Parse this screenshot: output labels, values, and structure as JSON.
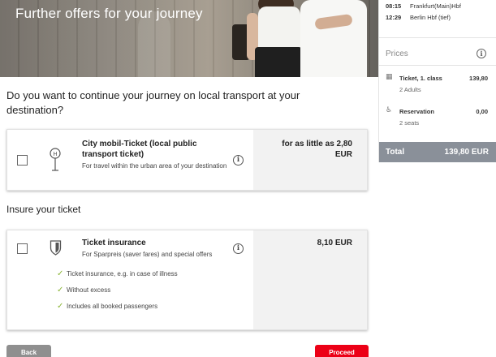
{
  "hero": {
    "title": "Further offers for your journey"
  },
  "sidebar": {
    "trip": [
      {
        "time": "08:15",
        "station": "Frankfurt(Main)Hbf"
      },
      {
        "time": "12:29",
        "station": "Berlin Hbf (tief)"
      }
    ],
    "prices_title": "Prices",
    "info_icon": "i",
    "items": [
      {
        "icon": "seat-icon",
        "label": "Ticket, 1. class",
        "sub": "2 Adults",
        "price": "139,80"
      },
      {
        "icon": "reservation-seat-icon",
        "label": "Reservation",
        "sub": "2 seats",
        "price": "0,00"
      }
    ],
    "total_label": "Total",
    "total_value": "139,80 EUR"
  },
  "main": {
    "question": "Do you want to continue your journey on local transport at your destination?",
    "city_ticket": {
      "title": "City mobil-Ticket (local public transport ticket)",
      "description": "For travel within the urban area of your destination",
      "price": "for as little as 2,80 EUR",
      "icon": "bus-stop-icon"
    },
    "insure_title": "Insure your ticket",
    "insurance": {
      "title": "Ticket insurance",
      "description": "For Sparpreis (saver fares) and special offers",
      "price": "8,10 EUR",
      "icon": "shield-icon",
      "features": [
        "Ticket insurance, e.g. in case of illness",
        "Without excess",
        "Includes all booked passengers"
      ]
    }
  },
  "buttons": {
    "back": "Back",
    "proceed": "Proceed"
  },
  "colors": {
    "accent": "#ec0016",
    "total_bar": "#8a9099",
    "check": "#8bb537"
  }
}
